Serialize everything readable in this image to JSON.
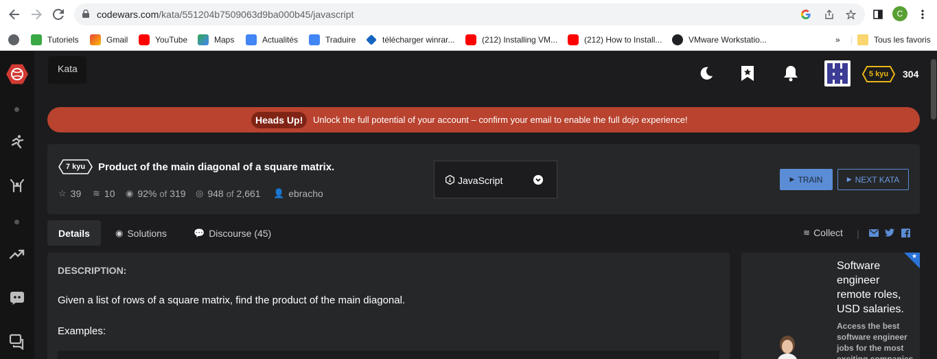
{
  "browser": {
    "url_host": "codewars.com",
    "url_path": "/kata/551204b7509063d9ba000b45/javascript",
    "profile_initial": "C",
    "bookmarks": [
      {
        "label": "Tutoriels",
        "icon": "tutoriels-favicon"
      },
      {
        "label": "Gmail",
        "icon": "gmail-favicon"
      },
      {
        "label": "YouTube",
        "icon": "youtube-favicon"
      },
      {
        "label": "Maps",
        "icon": "maps-favicon"
      },
      {
        "label": "Actualités",
        "icon": "news-favicon"
      },
      {
        "label": "Traduire",
        "icon": "translate-favicon"
      },
      {
        "label": "télécharger winrar...",
        "icon": "download-favicon"
      },
      {
        "label": "(212) Installing VM...",
        "icon": "youtube-favicon"
      },
      {
        "label": "(212) How to Install...",
        "icon": "youtube-favicon"
      },
      {
        "label": "VMware Workstatio...",
        "icon": "github-favicon"
      }
    ],
    "more_bookmarks": "»",
    "all_favorites": "Tous les favoris"
  },
  "topbar": {
    "tab_label": "Kata",
    "rank": "5 kyu",
    "honor": "304"
  },
  "banner": {
    "badge": "Heads Up!",
    "text": "Unlock the full potential of your account – confirm your email to enable the full dojo experience!"
  },
  "kata": {
    "rank": "7 kyu",
    "title": "Product of the main diagonal of a square matrix.",
    "stars": "39",
    "collections": "10",
    "satisfaction": "92%",
    "satisfaction_of": "of",
    "satisfaction_votes": "319",
    "completed": "948",
    "completed_of": "of",
    "completed_total": "2,661",
    "author": "ebracho",
    "language": "JavaScript",
    "train_label": "TRAIN",
    "next_label": "NEXT KATA"
  },
  "tabs": {
    "details": "Details",
    "solutions": "Solutions",
    "discourse": "Discourse (45)",
    "collect": "Collect",
    "separator": "|"
  },
  "description": {
    "heading": "DESCRIPTION:",
    "text": "Given a list of rows of a square matrix, find the product of the main diagonal.",
    "examples": "Examples:"
  },
  "ad": {
    "headline": "Software engineer remote roles, USD salaries.",
    "body": "Access the best software engineer jobs for the most exciting companies"
  },
  "colors": {
    "accent": "#5b8cd6",
    "banner": "#b9432f",
    "logo": "#d13a33",
    "rank_gold": "#ecb613"
  }
}
